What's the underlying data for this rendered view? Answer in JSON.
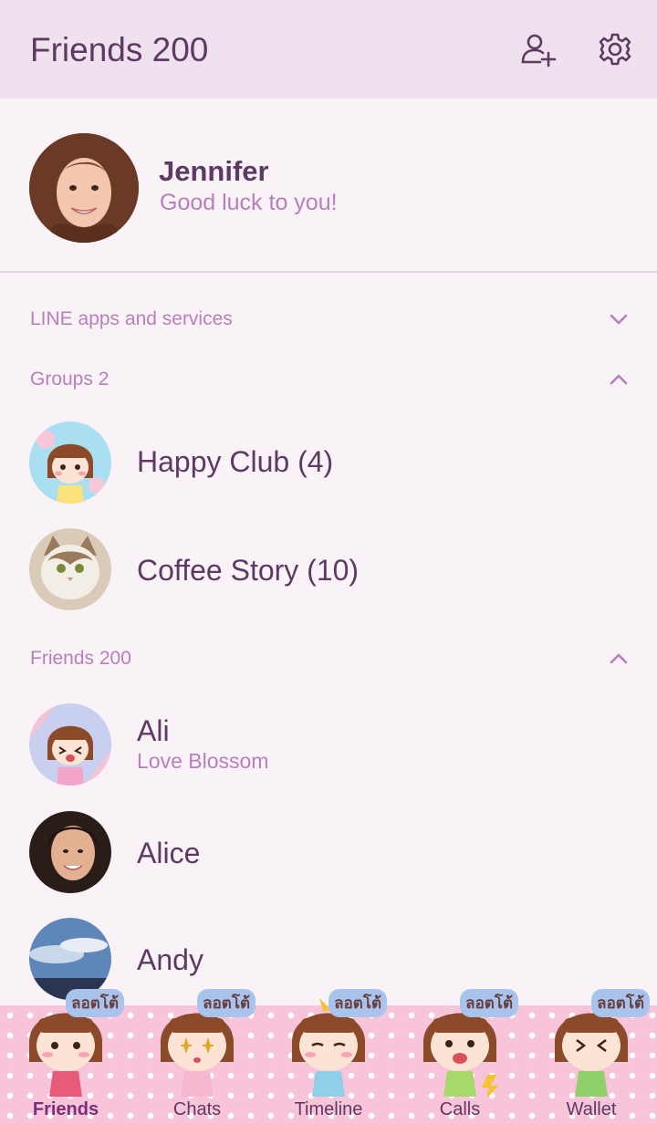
{
  "header": {
    "title": "Friends 200",
    "add_friend_icon": "add-friend-icon",
    "settings_icon": "gear-icon"
  },
  "profile": {
    "name": "Jennifer",
    "status": "Good luck to you!"
  },
  "sections": {
    "line_apps": "LINE apps and services",
    "groups": "Groups 2",
    "friends": "Friends 200"
  },
  "groups": [
    {
      "name": "Happy Club (4)"
    },
    {
      "name": "Coffee Story (10)"
    }
  ],
  "friends": [
    {
      "name": "Ali",
      "status": "Love Blossom"
    },
    {
      "name": "Alice",
      "status": ""
    },
    {
      "name": "Andy",
      "status": ""
    }
  ],
  "tabs": [
    {
      "label": "Friends",
      "badge": "ลอตโต้",
      "active": true
    },
    {
      "label": "Chats",
      "badge": "ลอตโต้",
      "active": false
    },
    {
      "label": "Timeline",
      "badge": "ลอตโต้",
      "active": false
    },
    {
      "label": "Calls",
      "badge": "ลอตโต้",
      "active": false
    },
    {
      "label": "Wallet",
      "badge": "ลอตโต้",
      "active": false
    }
  ],
  "colors": {
    "header_bg": "#efe1ee",
    "page_bg": "#f9f3f8",
    "text_primary": "#5e3a63",
    "text_secondary": "#b77fbb",
    "tabbar_bg": "#f8c4da"
  }
}
